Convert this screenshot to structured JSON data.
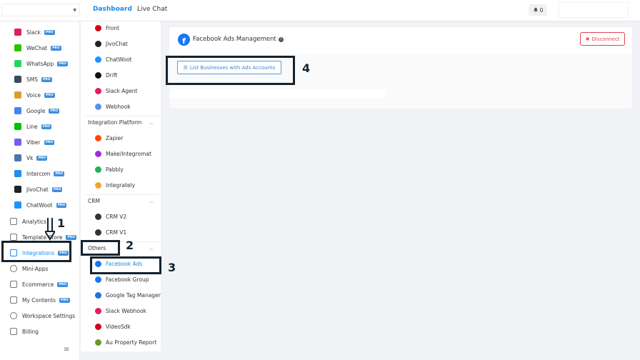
{
  "topbar": {
    "tabs": [
      {
        "label": "Dashboard"
      },
      {
        "label": "Live Chat"
      }
    ],
    "notifications_count": "0"
  },
  "sidebar": {
    "channels": [
      {
        "label": "Slack",
        "pro": "PRO",
        "icon": "slack-icon",
        "color": "#e01e5a"
      },
      {
        "label": "WeChat",
        "pro": "PRO",
        "icon": "wechat-icon",
        "color": "#2dc100"
      },
      {
        "label": "WhatsApp",
        "pro": "PRO",
        "icon": "whatsapp-icon",
        "color": "#25d366"
      },
      {
        "label": "SMS",
        "pro": "PRO",
        "icon": "sms-icon",
        "color": "#3c4a5c"
      },
      {
        "label": "Voice",
        "pro": "PRO",
        "icon": "voice-icon",
        "color": "#d5a130"
      },
      {
        "label": "Google",
        "pro": "PRO",
        "icon": "google-icon",
        "color": "#4285f4"
      },
      {
        "label": "Line",
        "pro": "PRO",
        "icon": "line-icon",
        "color": "#00c300"
      },
      {
        "label": "Viber",
        "pro": "PRO",
        "icon": "viber-icon",
        "color": "#7360f2"
      },
      {
        "label": "Vk",
        "pro": "PRO",
        "icon": "vk-icon",
        "color": "#4a76a8"
      },
      {
        "label": "Intercom",
        "pro": "PRO",
        "icon": "intercom-icon",
        "color": "#1f8ded"
      },
      {
        "label": "JivoChat",
        "pro": "PRO",
        "icon": "jivochat-icon",
        "color": "#222222"
      },
      {
        "label": "ChatWoot",
        "pro": "PRO",
        "icon": "chatwoot-icon",
        "color": "#1f93ff"
      }
    ],
    "analytics": "Analytics",
    "template_store": "Template Store",
    "template_store_pro": "PRO",
    "integrations": "Integrations",
    "integrations_pro": "PRO",
    "mini_apps": "Mini-Apps",
    "ecommerce": "Ecommerce",
    "ecommerce_pro": "PRO",
    "my_contents": "My Contents",
    "my_contents_pro": "PRO",
    "workspace_settings": "Workspace Settings",
    "billing": "Billing"
  },
  "subnav": {
    "chat_items": [
      {
        "label": "Front",
        "icon": "front-icon",
        "color": "#d0021b"
      },
      {
        "label": "JivoChat",
        "icon": "jivochat-icon",
        "color": "#222222"
      },
      {
        "label": "ChatWoot",
        "icon": "chatwoot-icon",
        "color": "#1f93ff"
      },
      {
        "label": "Drift",
        "icon": "drift-icon",
        "color": "#111111"
      },
      {
        "label": "Slack Agent",
        "icon": "slack-icon",
        "color": "#e01e5a"
      },
      {
        "label": "Webhook",
        "icon": "webhook-icon",
        "color": "#5b8def"
      }
    ],
    "section_integration": "Integration Platform",
    "integration_items": [
      {
        "label": "Zapier",
        "icon": "zapier-icon",
        "color": "#ff4a00"
      },
      {
        "label": "Make/Integromat",
        "icon": "make-icon",
        "color": "#a32ae4"
      },
      {
        "label": "Pabbly",
        "icon": "pabbly-icon",
        "color": "#20b15a"
      },
      {
        "label": "Integrately",
        "icon": "integrately-icon",
        "color": "#f5a623"
      }
    ],
    "section_crm": "CRM",
    "crm_items": [
      {
        "label": "CRM V2",
        "icon": "crm-icon",
        "color": "#333333"
      },
      {
        "label": "CRM V1",
        "icon": "crm-icon",
        "color": "#333333"
      }
    ],
    "section_others": "Others",
    "others_items": [
      {
        "label": "Facebook Ads",
        "icon": "facebook-icon",
        "color": "#1877f2"
      },
      {
        "label": "Facebook Group",
        "icon": "facebook-icon",
        "color": "#1877f2"
      },
      {
        "label": "Google Tag Manager",
        "icon": "google-tag-manager-icon",
        "color": "#246fdb"
      },
      {
        "label": "Slack Webhook",
        "icon": "slack-icon",
        "color": "#e01e5a"
      },
      {
        "label": "VideoSdk",
        "icon": "videosdk-icon",
        "color": "#d0021b"
      },
      {
        "label": "Au Property Report",
        "icon": "au-property-icon",
        "color": "#6a9a2c"
      }
    ]
  },
  "main": {
    "title": "Facebook Ads Management",
    "disconnect_label": "Disconnect",
    "list_button_label": "List Businesses with Ads Accounts"
  },
  "annotations": [
    "1",
    "2",
    "3",
    "4"
  ]
}
